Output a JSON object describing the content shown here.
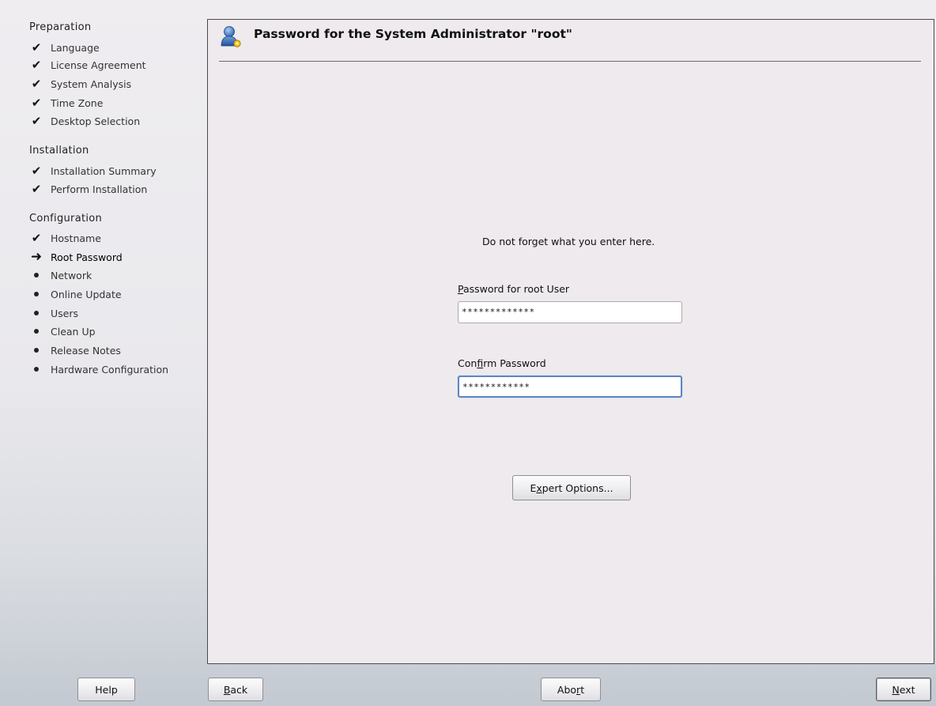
{
  "sidebar": {
    "sections": [
      {
        "title": "Preparation",
        "steps": [
          {
            "label": "Language",
            "state": "done"
          },
          {
            "label": "License Agreement",
            "state": "done"
          },
          {
            "label": "System Analysis",
            "state": "done"
          },
          {
            "label": "Time Zone",
            "state": "done"
          },
          {
            "label": "Desktop Selection",
            "state": "done"
          }
        ]
      },
      {
        "title": "Installation",
        "steps": [
          {
            "label": "Installation Summary",
            "state": "done"
          },
          {
            "label": "Perform Installation",
            "state": "done"
          }
        ]
      },
      {
        "title": "Configuration",
        "steps": [
          {
            "label": "Hostname",
            "state": "done"
          },
          {
            "label": "Root Password",
            "state": "current"
          },
          {
            "label": "Network",
            "state": "pending"
          },
          {
            "label": "Online Update",
            "state": "pending"
          },
          {
            "label": "Users",
            "state": "pending"
          },
          {
            "label": "Clean Up",
            "state": "pending"
          },
          {
            "label": "Release Notes",
            "state": "pending"
          },
          {
            "label": "Hardware Configuration",
            "state": "pending"
          }
        ]
      }
    ]
  },
  "header": {
    "icon": "user-admin-icon",
    "title": "Password for the System Administrator \"root\""
  },
  "form": {
    "hint": "Do not forget what you enter here.",
    "password_label_mnemonic": "P",
    "password_label_rest": "assword for root User",
    "password_value": "*************",
    "confirm_label_pre": "Con",
    "confirm_label_mnemonic": "f",
    "confirm_label_rest": "irm Password",
    "confirm_value": "************",
    "expert_pre": "E",
    "expert_mnemonic": "x",
    "expert_rest": "pert Options..."
  },
  "footer": {
    "help_label": "Help",
    "back_mnemonic": "B",
    "back_rest": "ack",
    "abort_pre": "Abo",
    "abort_mnemonic": "r",
    "abort_rest": "t",
    "next_mnemonic": "N",
    "next_rest": "ext"
  },
  "colors": {
    "focus_border": "#5b86c6",
    "panel_bg": "#eeeaed"
  }
}
